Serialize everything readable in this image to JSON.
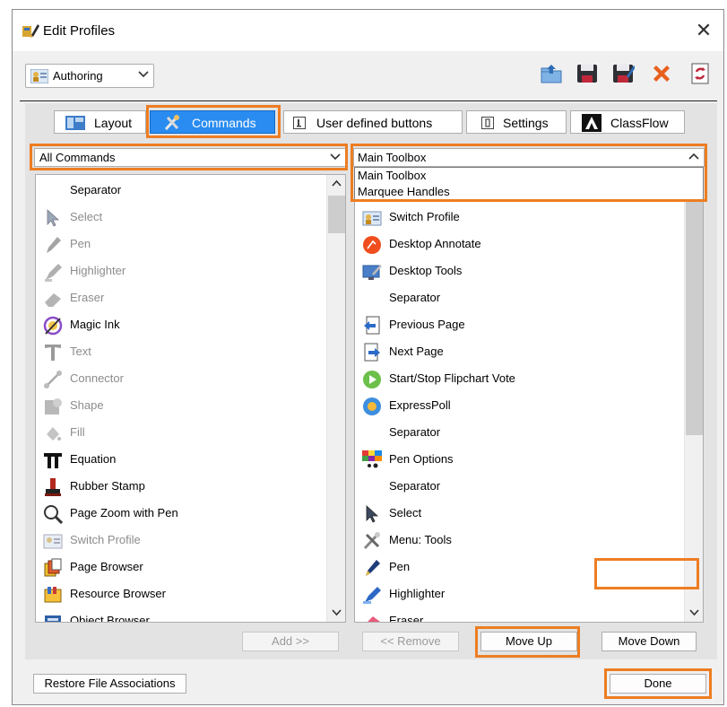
{
  "window": {
    "title": "Edit Profiles",
    "close_glyph": "✕"
  },
  "profile": {
    "selected": "Authoring"
  },
  "toolbar_icons": [
    "folder-export-icon",
    "save-icon",
    "save-as-icon",
    "delete-icon",
    "refresh-icon"
  ],
  "tabs": [
    {
      "label": "Layout"
    },
    {
      "label": "Commands"
    },
    {
      "label": "User defined buttons"
    },
    {
      "label": "Settings"
    },
    {
      "label": "ClassFlow"
    }
  ],
  "left_filter": {
    "selected": "All Commands"
  },
  "right_filter": {
    "selected": "Main Toolbox",
    "options": [
      "Main Toolbox",
      "Marquee Handles"
    ]
  },
  "left_items": [
    {
      "label": "Separator",
      "icon": "none",
      "enabled": true
    },
    {
      "label": "Select",
      "icon": "arrow-cursor-icon",
      "enabled": false
    },
    {
      "label": "Pen",
      "icon": "pen-icon",
      "enabled": false
    },
    {
      "label": "Highlighter",
      "icon": "highlighter-icon",
      "enabled": false
    },
    {
      "label": "Eraser",
      "icon": "eraser-icon",
      "enabled": false
    },
    {
      "label": "Magic Ink",
      "icon": "magic-ink-icon",
      "enabled": true
    },
    {
      "label": "Text",
      "icon": "text-icon",
      "enabled": false
    },
    {
      "label": "Connector",
      "icon": "connector-icon",
      "enabled": false
    },
    {
      "label": "Shape",
      "icon": "shape-icon",
      "enabled": false
    },
    {
      "label": "Fill",
      "icon": "fill-icon",
      "enabled": false
    },
    {
      "label": "Equation",
      "icon": "pi-icon",
      "enabled": true
    },
    {
      "label": "Rubber Stamp",
      "icon": "stamp-icon",
      "enabled": true
    },
    {
      "label": "Page Zoom with Pen",
      "icon": "magnifier-icon",
      "enabled": true
    },
    {
      "label": "Switch Profile",
      "icon": "profile-icon",
      "enabled": false
    },
    {
      "label": "Page Browser",
      "icon": "page-browser-icon",
      "enabled": true
    },
    {
      "label": "Resource Browser",
      "icon": "resource-browser-icon",
      "enabled": true
    },
    {
      "label": "Object Browser",
      "icon": "object-browser-icon",
      "enabled": true
    }
  ],
  "right_items": [
    {
      "label": "Switch Profile",
      "icon": "profile-icon"
    },
    {
      "label": "Desktop Annotate",
      "icon": "desktop-annotate-icon"
    },
    {
      "label": "Desktop Tools",
      "icon": "desktop-tools-icon"
    },
    {
      "label": "Separator",
      "icon": "none"
    },
    {
      "label": "Previous Page",
      "icon": "previous-page-icon"
    },
    {
      "label": "Next Page",
      "icon": "next-page-icon"
    },
    {
      "label": "Start/Stop Flipchart Vote",
      "icon": "play-icon"
    },
    {
      "label": "ExpressPoll",
      "icon": "expresspoll-icon"
    },
    {
      "label": "Separator",
      "icon": "none"
    },
    {
      "label": "Pen Options",
      "icon": "palette-icon"
    },
    {
      "label": "Separator",
      "icon": "none"
    },
    {
      "label": "Select",
      "icon": "arrow-cursor-icon"
    },
    {
      "label": "Menu: Tools",
      "icon": "tools-icon"
    },
    {
      "label": "Pen",
      "icon": "pen-icon"
    },
    {
      "label": "Highlighter",
      "icon": "highlighter-icon"
    },
    {
      "label": "Eraser",
      "icon": "eraser-icon"
    }
  ],
  "buttons": {
    "add": "Add >>",
    "remove": "<< Remove",
    "move_up": "Move Up",
    "move_down": "Move Down",
    "restore": "Restore File Associations",
    "done": "Done"
  },
  "colors": {
    "highlight": "#ed7d22",
    "selected_tab": "#2a8cf0"
  }
}
